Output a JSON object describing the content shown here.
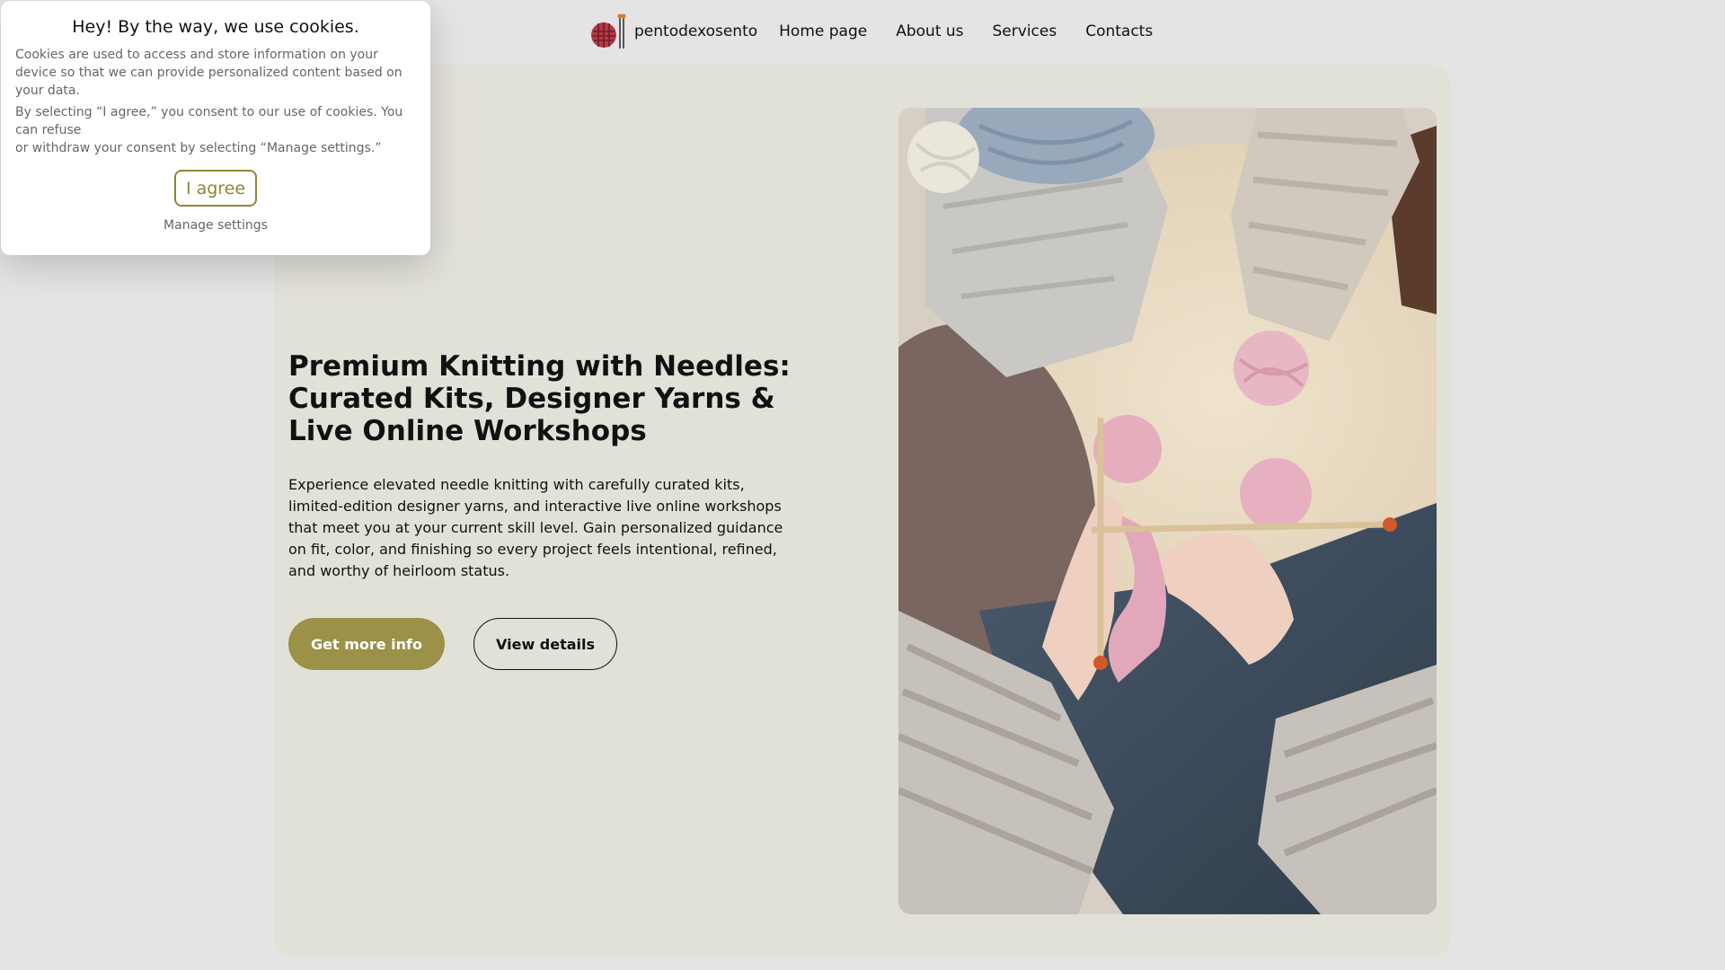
{
  "nav": {
    "brand": "pentodexosento",
    "links": [
      "Home page",
      "About us",
      "Services",
      "Contacts"
    ]
  },
  "hero": {
    "title": "Premium Knitting with Needles: Curated Kits, Designer Yarns & Live Online Workshops",
    "description": "Experience elevated needle knitting with carefully curated kits, limited-edition designer yarns, and interactive live online workshops that meet you at your current skill level. Gain personalized guidance on fit, color, and finishing so every project feels intentional, refined, and worthy of heirloom status.",
    "primary_button": "Get more info",
    "secondary_button": "View details"
  },
  "cookie": {
    "title": "Hey! By the way, we use cookies.",
    "paragraph1": "Cookies are used to access and store information on your device so that we can provide personalized content based on your data.",
    "paragraph2_line1": "By selecting “I agree,” you consent to our use of cookies. You can refuse",
    "paragraph2_line2": "or withdraw your consent by selecting “Manage settings.”",
    "agree_button": "I agree",
    "manage_link": "Manage settings"
  },
  "colors": {
    "accent": "#9b9148",
    "hero_background": "#e2e1d8",
    "page_background": "#e4e4e4"
  },
  "icons": {
    "logo": "yarn-ball-with-needles-icon"
  }
}
